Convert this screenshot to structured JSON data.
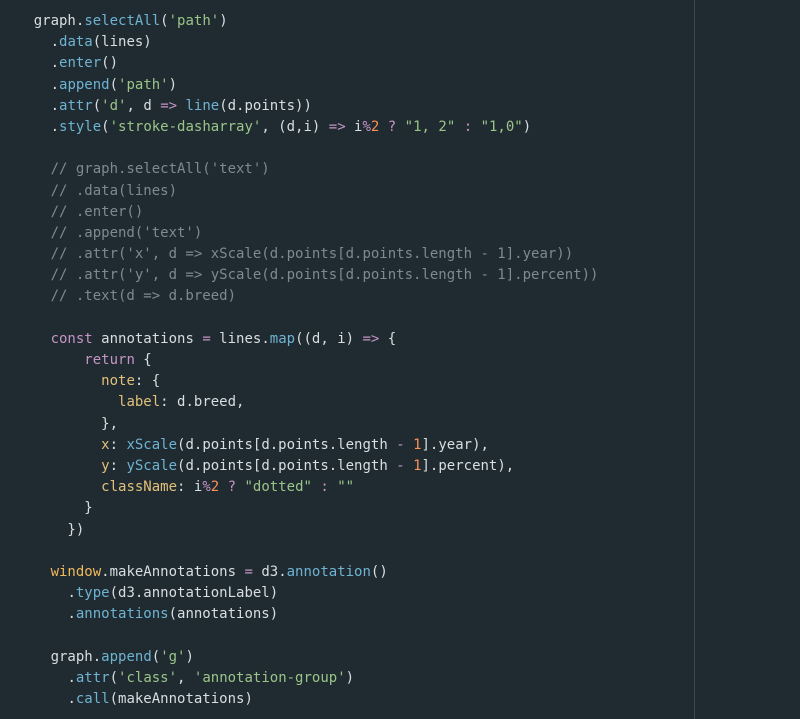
{
  "theme": {
    "background": "#1f2b31",
    "ruler_color": "#3a474d",
    "colors": {
      "plain": "#d8dee2",
      "method": "#6fb3d2",
      "string": "#9bc488",
      "keyword": "#c594c5",
      "number": "#f99157",
      "property": "#e2c07a",
      "global": "#f0b85a",
      "comment": "#7d8a90"
    }
  },
  "code": {
    "lines": [
      [
        [
          "graph",
          "plain"
        ],
        [
          ".",
          "plain"
        ],
        [
          "selectAll",
          "method"
        ],
        [
          "(",
          "plain"
        ],
        [
          "'path'",
          "string"
        ],
        [
          ")",
          "plain"
        ]
      ],
      [
        [
          "  ",
          "plain"
        ],
        [
          ".",
          "plain"
        ],
        [
          "data",
          "method"
        ],
        [
          "(lines)",
          "plain"
        ]
      ],
      [
        [
          "  ",
          "plain"
        ],
        [
          ".",
          "plain"
        ],
        [
          "enter",
          "method"
        ],
        [
          "()",
          "plain"
        ]
      ],
      [
        [
          "  ",
          "plain"
        ],
        [
          ".",
          "plain"
        ],
        [
          "append",
          "method"
        ],
        [
          "(",
          "plain"
        ],
        [
          "'path'",
          "string"
        ],
        [
          ")",
          "plain"
        ]
      ],
      [
        [
          "  ",
          "plain"
        ],
        [
          ".",
          "plain"
        ],
        [
          "attr",
          "method"
        ],
        [
          "(",
          "plain"
        ],
        [
          "'d'",
          "string"
        ],
        [
          ", d ",
          "plain"
        ],
        [
          "=>",
          "keyword"
        ],
        [
          " ",
          "plain"
        ],
        [
          "line",
          "method"
        ],
        [
          "(d.points))",
          "plain"
        ]
      ],
      [
        [
          "  ",
          "plain"
        ],
        [
          ".",
          "plain"
        ],
        [
          "style",
          "method"
        ],
        [
          "(",
          "plain"
        ],
        [
          "'stroke-dasharray'",
          "string"
        ],
        [
          ", (d,i) ",
          "plain"
        ],
        [
          "=>",
          "keyword"
        ],
        [
          " i",
          "plain"
        ],
        [
          "%",
          "keyword"
        ],
        [
          "2",
          "number"
        ],
        [
          " ",
          "plain"
        ],
        [
          "?",
          "keyword"
        ],
        [
          " ",
          "plain"
        ],
        [
          "\"1, 2\"",
          "string"
        ],
        [
          " ",
          "plain"
        ],
        [
          ":",
          "keyword"
        ],
        [
          " ",
          "plain"
        ],
        [
          "\"1,0\"",
          "string"
        ],
        [
          ")",
          "plain"
        ]
      ],
      [],
      [
        [
          "  // graph.selectAll('text')",
          "comment"
        ]
      ],
      [
        [
          "  // .data(lines)",
          "comment"
        ]
      ],
      [
        [
          "  // .enter()",
          "comment"
        ]
      ],
      [
        [
          "  // .append('text')",
          "comment"
        ]
      ],
      [
        [
          "  // .attr('x', d => xScale(d.points[d.points.length - 1].year))",
          "comment"
        ]
      ],
      [
        [
          "  // .attr('y', d => yScale(d.points[d.points.length - 1].percent))",
          "comment"
        ]
      ],
      [
        [
          "  // .text(d => d.breed)",
          "comment"
        ]
      ],
      [],
      [
        [
          "  ",
          "plain"
        ],
        [
          "const",
          "keyword"
        ],
        [
          " annotations ",
          "plain"
        ],
        [
          "=",
          "keyword"
        ],
        [
          " lines.",
          "plain"
        ],
        [
          "map",
          "method"
        ],
        [
          "((d, i) ",
          "plain"
        ],
        [
          "=>",
          "keyword"
        ],
        [
          " {",
          "plain"
        ]
      ],
      [
        [
          "      ",
          "plain"
        ],
        [
          "return",
          "keyword"
        ],
        [
          " {",
          "plain"
        ]
      ],
      [
        [
          "        ",
          "plain"
        ],
        [
          "note",
          "property"
        ],
        [
          ": {",
          "plain"
        ]
      ],
      [
        [
          "          ",
          "plain"
        ],
        [
          "label",
          "property"
        ],
        [
          ": d.breed,",
          "plain"
        ]
      ],
      [
        [
          "        },",
          "plain"
        ]
      ],
      [
        [
          "        ",
          "plain"
        ],
        [
          "x",
          "property"
        ],
        [
          ": ",
          "plain"
        ],
        [
          "xScale",
          "method"
        ],
        [
          "(d.points[d.points.length ",
          "plain"
        ],
        [
          "-",
          "keyword"
        ],
        [
          " ",
          "plain"
        ],
        [
          "1",
          "number"
        ],
        [
          "].year),",
          "plain"
        ]
      ],
      [
        [
          "        ",
          "plain"
        ],
        [
          "y",
          "property"
        ],
        [
          ": ",
          "plain"
        ],
        [
          "yScale",
          "method"
        ],
        [
          "(d.points[d.points.length ",
          "plain"
        ],
        [
          "-",
          "keyword"
        ],
        [
          " ",
          "plain"
        ],
        [
          "1",
          "number"
        ],
        [
          "].percent),",
          "plain"
        ]
      ],
      [
        [
          "        ",
          "plain"
        ],
        [
          "className",
          "property"
        ],
        [
          ": i",
          "plain"
        ],
        [
          "%",
          "keyword"
        ],
        [
          "2",
          "number"
        ],
        [
          " ",
          "plain"
        ],
        [
          "?",
          "keyword"
        ],
        [
          " ",
          "plain"
        ],
        [
          "\"dotted\"",
          "string"
        ],
        [
          " ",
          "plain"
        ],
        [
          ":",
          "keyword"
        ],
        [
          " ",
          "plain"
        ],
        [
          "\"\"",
          "string"
        ]
      ],
      [
        [
          "      }",
          "plain"
        ]
      ],
      [
        [
          "    })",
          "plain"
        ]
      ],
      [],
      [
        [
          "  ",
          "plain"
        ],
        [
          "window",
          "global"
        ],
        [
          ".",
          "plain"
        ],
        [
          "makeAnnotations",
          "plain"
        ],
        [
          " ",
          "plain"
        ],
        [
          "=",
          "keyword"
        ],
        [
          " d3.",
          "plain"
        ],
        [
          "annotation",
          "method"
        ],
        [
          "()",
          "plain"
        ]
      ],
      [
        [
          "    ",
          "plain"
        ],
        [
          ".",
          "plain"
        ],
        [
          "type",
          "method"
        ],
        [
          "(d3.annotationLabel)",
          "plain"
        ]
      ],
      [
        [
          "    ",
          "plain"
        ],
        [
          ".",
          "plain"
        ],
        [
          "annotations",
          "method"
        ],
        [
          "(annotations)",
          "plain"
        ]
      ],
      [],
      [
        [
          "  graph",
          "plain"
        ],
        [
          ".",
          "plain"
        ],
        [
          "append",
          "method"
        ],
        [
          "(",
          "plain"
        ],
        [
          "'g'",
          "string"
        ],
        [
          ")",
          "plain"
        ]
      ],
      [
        [
          "    ",
          "plain"
        ],
        [
          ".",
          "plain"
        ],
        [
          "attr",
          "method"
        ],
        [
          "(",
          "plain"
        ],
        [
          "'class'",
          "string"
        ],
        [
          ", ",
          "plain"
        ],
        [
          "'annotation-group'",
          "string"
        ],
        [
          ")",
          "plain"
        ]
      ],
      [
        [
          "    ",
          "plain"
        ],
        [
          ".",
          "plain"
        ],
        [
          "call",
          "method"
        ],
        [
          "(makeAnnotations)",
          "plain"
        ]
      ]
    ]
  }
}
